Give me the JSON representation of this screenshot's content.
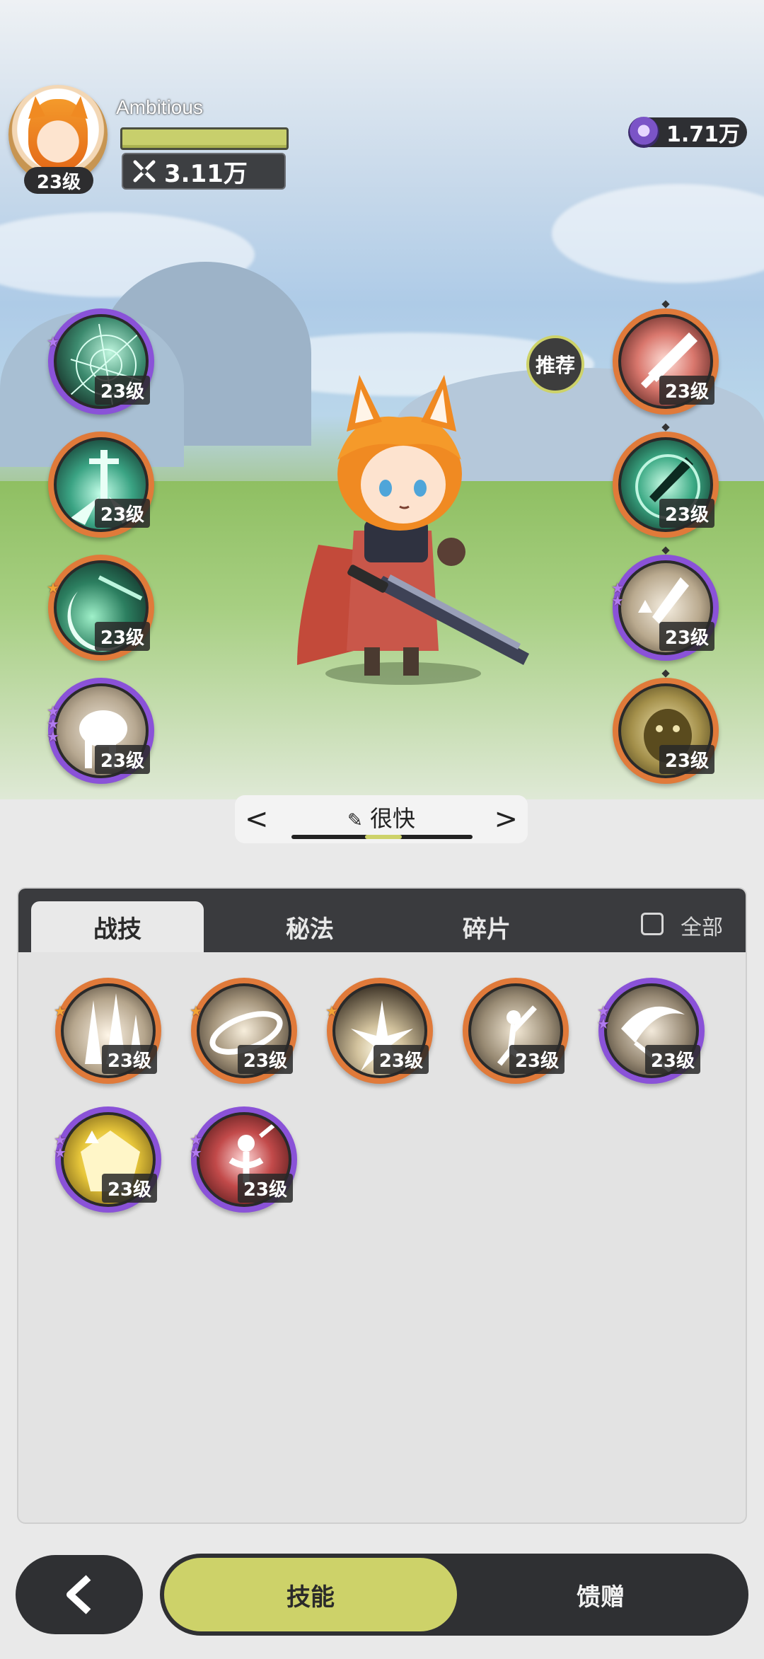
{
  "player": {
    "name": "Ambitious",
    "level": "23级",
    "power": "3.11万",
    "hp_fraction": 1.0
  },
  "currency": {
    "amount": "1.71万",
    "icon": "purple-gem-icon"
  },
  "recommend_label": "推荐",
  "left_skills": [
    {
      "level": "23级",
      "icon": "web-net-icon",
      "rarity": "purple",
      "stars": 1
    },
    {
      "level": "23级",
      "icon": "sword-burst-icon",
      "rarity": "orange",
      "stars": 0
    },
    {
      "level": "23级",
      "icon": "crescent-slash-icon",
      "rarity": "orange",
      "stars": 1
    },
    {
      "level": "23级",
      "icon": "beast-charge-icon",
      "rarity": "purple",
      "stars": 3
    }
  ],
  "right_skills": [
    {
      "level": "23级",
      "icon": "red-sword-icon",
      "rarity": "orange",
      "stars": 0
    },
    {
      "level": "23级",
      "icon": "green-sword-icon",
      "rarity": "orange",
      "stars": 0
    },
    {
      "level": "23级",
      "icon": "sword-upgrade-icon",
      "rarity": "purple",
      "stars": 2
    },
    {
      "level": "23级",
      "icon": "golem-icon",
      "rarity": "orange",
      "stars": 0
    }
  ],
  "speed": {
    "label": "很快",
    "prev": "<",
    "next": ">"
  },
  "tabs": {
    "t1": "战技",
    "t2": "秘法",
    "t3": "碎片",
    "all": "全部"
  },
  "panel_skills": [
    {
      "level": "23级",
      "icon": "ground-spikes-icon",
      "rarity": "orange",
      "stars": 1
    },
    {
      "level": "23级",
      "icon": "whirlwind-icon",
      "rarity": "orange",
      "stars": 1
    },
    {
      "level": "23级",
      "icon": "explosion-icon",
      "rarity": "orange",
      "stars": 1
    },
    {
      "level": "23级",
      "icon": "warrior-leap-icon",
      "rarity": "orange",
      "stars": 0
    },
    {
      "level": "23级",
      "icon": "scythe-sweep-icon",
      "rarity": "purple",
      "stars": 2
    },
    {
      "level": "23级",
      "icon": "golden-shield-icon",
      "rarity": "purple",
      "stars": 2
    },
    {
      "level": "23级",
      "icon": "sacrifice-figure-icon",
      "rarity": "purple",
      "stars": 2
    }
  ],
  "bottom": {
    "skills": "技能",
    "gift": "馈赠"
  }
}
